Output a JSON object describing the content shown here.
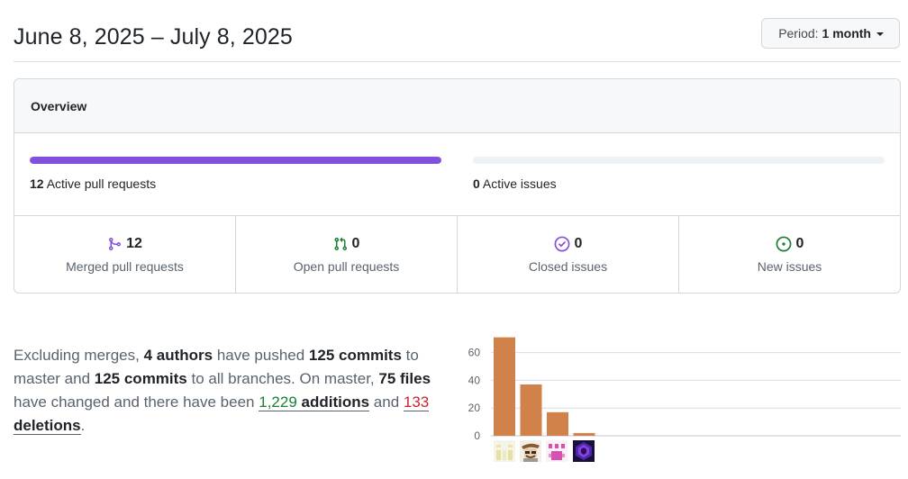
{
  "header": {
    "date_range": "June 8, 2025 – July 8, 2025",
    "period_label": "Period:",
    "period_value": "1 month"
  },
  "overview": {
    "title": "Overview",
    "pull_requests": {
      "count": "12",
      "label": "Active pull requests",
      "fill_fraction": 1.0,
      "color": "#8250df"
    },
    "issues": {
      "count": "0",
      "label": "Active issues",
      "fill_fraction": 0.0
    },
    "stats": [
      {
        "icon": "merged-pr-icon",
        "value": "12",
        "label": "Merged pull requests",
        "color": "#8250df"
      },
      {
        "icon": "open-pr-icon",
        "value": "0",
        "label": "Open pull requests",
        "color": "#1a7f37"
      },
      {
        "icon": "closed-issue-icon",
        "value": "0",
        "label": "Closed issues",
        "color": "#8250df"
      },
      {
        "icon": "new-issue-icon",
        "value": "0",
        "label": "New issues",
        "color": "#1a7f37"
      }
    ]
  },
  "summary": {
    "t1": "Excluding merges, ",
    "authors": "4 authors",
    "t2": " have pushed ",
    "commits_master": "125 commits",
    "t3": " to master and ",
    "commits_all": "125 commits",
    "t4": " to all branches. On master, ",
    "files": "75 files",
    "t5": " have changed and there have been ",
    "additions_num": "1,229",
    "additions_word": " additions",
    "t6": " and ",
    "deletions_num": "133",
    "deletions_word": " deletions",
    "t7": "."
  },
  "chart_data": {
    "type": "bar",
    "categories": [
      "author-1",
      "author-2",
      "author-3",
      "author-4"
    ],
    "values": [
      71,
      37,
      17,
      2
    ],
    "yticks": [
      0,
      20,
      40,
      60
    ],
    "ylim": [
      0,
      75
    ],
    "bar_color": "#d0824a",
    "grid": true
  }
}
